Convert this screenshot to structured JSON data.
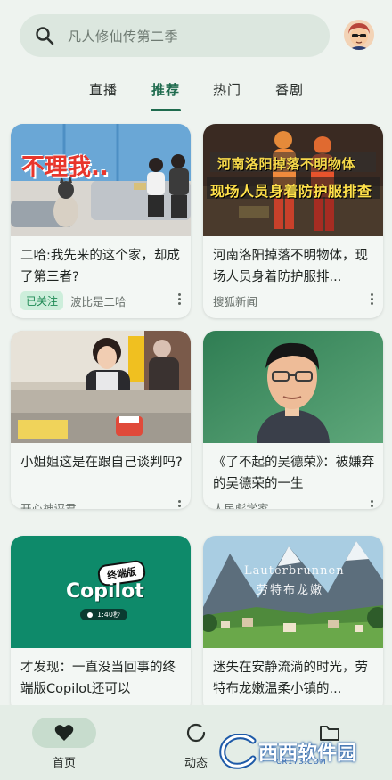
{
  "search": {
    "placeholder": "凡人修仙传第二季"
  },
  "tabs": [
    {
      "label": "直播",
      "active": false
    },
    {
      "label": "推荐",
      "active": true
    },
    {
      "label": "热门",
      "active": false
    },
    {
      "label": "番剧",
      "active": false
    }
  ],
  "cards": [
    {
      "title": "二哈:我先来的这个家，却成了第三者?",
      "badge": "已关注",
      "source": "波比是二哈",
      "thumb_text": "不理我..",
      "thumb_bg": "#7fb6e0"
    },
    {
      "title": "河南洛阳掉落不明物体，现场人员身着防护服排...",
      "source": "搜狐新闻",
      "thumb_line1": "河南洛阳掉落不明物体",
      "thumb_line2": "现场人员身着防护服排查",
      "thumb_bg": "#3a2a22"
    },
    {
      "title": "小姐姐这是在跟自己谈判吗?",
      "source": "开心神评君",
      "thumb_bg": "#c9c2b5"
    },
    {
      "title": "《了不起的吴德荣》：被嫌弃的吴德荣的一生",
      "source": "人民彪学家",
      "thumb_bg": "#3f8a5e"
    },
    {
      "title": "才发现：一直没当回事的终端版Copilot还可以",
      "thumb_badge": "终端版",
      "thumb_title": "Copilot",
      "thumb_time": "1:40秒",
      "thumb_bg": "#0e8a6a"
    },
    {
      "title": "迷失在安静流淌的时光，劳特布龙嫩温柔小镇的...",
      "thumb_line1": "Lauterbrunnen",
      "thumb_line2": "劳特布龙嫩",
      "thumb_bg": "#8ab6cf"
    }
  ],
  "bottom_nav": [
    {
      "label": "首页",
      "icon": "heart-icon",
      "active": true
    },
    {
      "label": "动态",
      "icon": "loading-ring-icon",
      "active": false
    },
    {
      "label": "",
      "icon": "folder-icon",
      "active": false
    }
  ],
  "watermark": {
    "text": "西西软件园",
    "sub": "CR173.COM"
  },
  "colors": {
    "accent": "#1f6b4e",
    "background": "#eef3ef",
    "badge_bg": "#cdeedb"
  }
}
